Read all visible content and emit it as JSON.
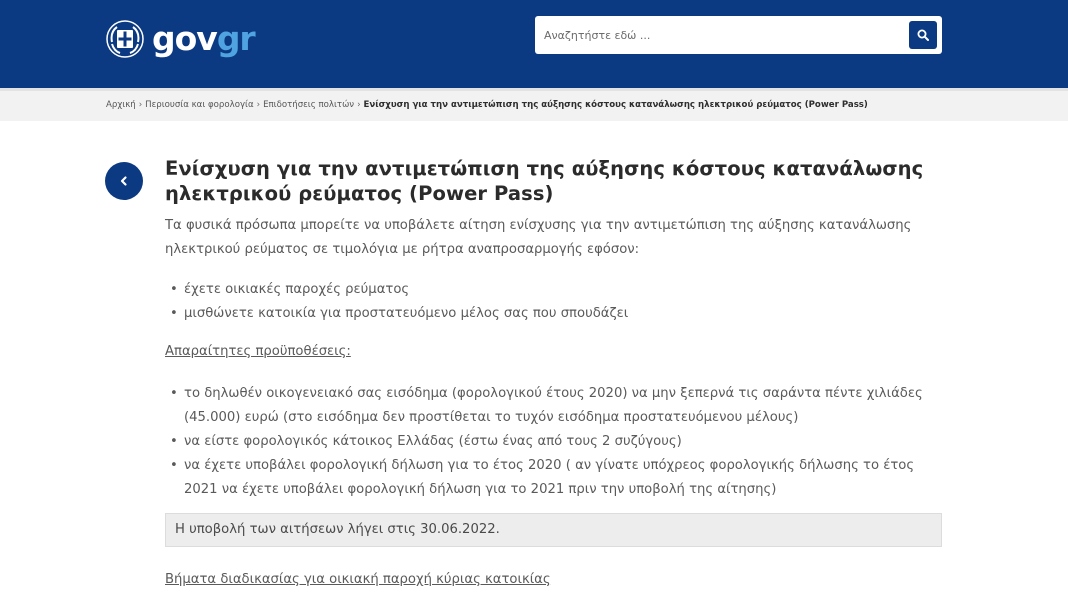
{
  "header": {
    "logo_text_a": "gov",
    "logo_text_b": "gr",
    "search_placeholder": "Αναζητήστε εδώ ...",
    "colors": {
      "header_bg": "#0c3a82",
      "logo_accent": "#4fa3e0"
    },
    "icons": {
      "emblem": "greek-emblem-icon",
      "search": "search-icon"
    }
  },
  "breadcrumb": {
    "items": [
      "Αρχική",
      "Περιουσία και φορολογία",
      "Επιδοτήσεις πολιτών"
    ],
    "current": "Ενίσχυση για την αντιμετώπιση της αύξησης κόστους κατανάλωσης ηλεκτρικού ρεύματος (Power Pass)"
  },
  "page": {
    "back_icon": "chevron-left-icon",
    "title": "Ενίσχυση για την αντιμετώπιση της αύξησης κόστους κατανάλωσης ηλεκτρικού ρεύματος (Power Pass)",
    "intro": "Τα φυσικά πρόσωπα μπορείτε να υποβάλετε αίτηση ενίσχυσης για την αντιμετώπιση της αύξησης κατανάλωσης ηλεκτρικού ρεύματος σε τιμολόγια με ρήτρα αναπροσαρμογής εφόσον:",
    "conditions": [
      "έχετε οικιακές παροχές ρεύματος",
      "μισθώνετε κατοικία για προστατευόμενο μέλος σας που σπουδάζει"
    ],
    "requirements_heading": "Απαραίτητες προϋποθέσεις:",
    "requirements": [
      "το δηλωθέν οικογενειακό σας εισόδημα (φορολογικού έτους 2020) να μην ξεπερνά τις σαράντα πέντε χιλιάδες (45.000) ευρώ (στο εισόδημα δεν προστίθεται το τυχόν εισόδημα προστατευόμενου μέλους)",
      "να είστε φορολογικός κάτοικος Ελλάδας (έστω ένας από τους 2 συζύγους)",
      "να έχετε υποβάλει φορολογική δήλωση για το έτος 2020 ( αν γίνατε υπόχρεος φορολογικής δήλωσης το έτος 2021 να έχετε υποβάλει φορολογική δήλωση για το 2021 πριν την υποβολή της αίτησης)"
    ],
    "notice": "Η υποβολή των αιτήσεων λήγει στις 30.06.2022.",
    "steps_link": "Βήματα διαδικασίας για οικιακή παροχή κύριας κατοικίας"
  }
}
